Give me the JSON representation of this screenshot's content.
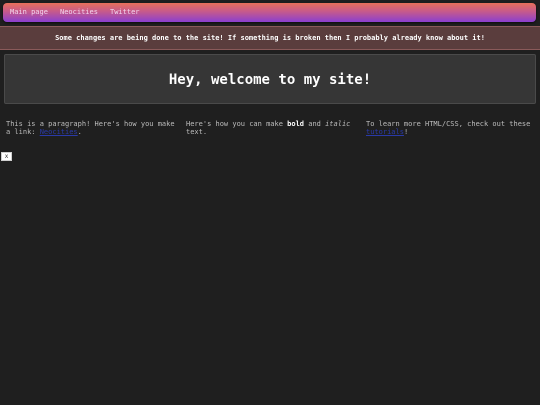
{
  "nav": {
    "items": [
      {
        "label": "Main page"
      },
      {
        "label": "Neocities"
      },
      {
        "label": "Twitter"
      }
    ]
  },
  "notice": {
    "text": "Some changes are being done to the site! If something is broken then I probably already know about it!"
  },
  "header": {
    "title": "Hey, welcome to my site!"
  },
  "columns": {
    "col1": {
      "text_before": "This is a paragraph! Here's how you make a link: ",
      "link_label": "Neocities",
      "text_after": "."
    },
    "col2": {
      "text_before": "Here's how you can make ",
      "bold": "bold",
      "text_middle": " and ",
      "italic": "italic",
      "text_after": " text."
    },
    "col3": {
      "text_before": "To learn more HTML/CSS, check out these ",
      "link_label": "tutorials",
      "text_after": "!"
    }
  },
  "tiny_button": {
    "label": "x"
  }
}
